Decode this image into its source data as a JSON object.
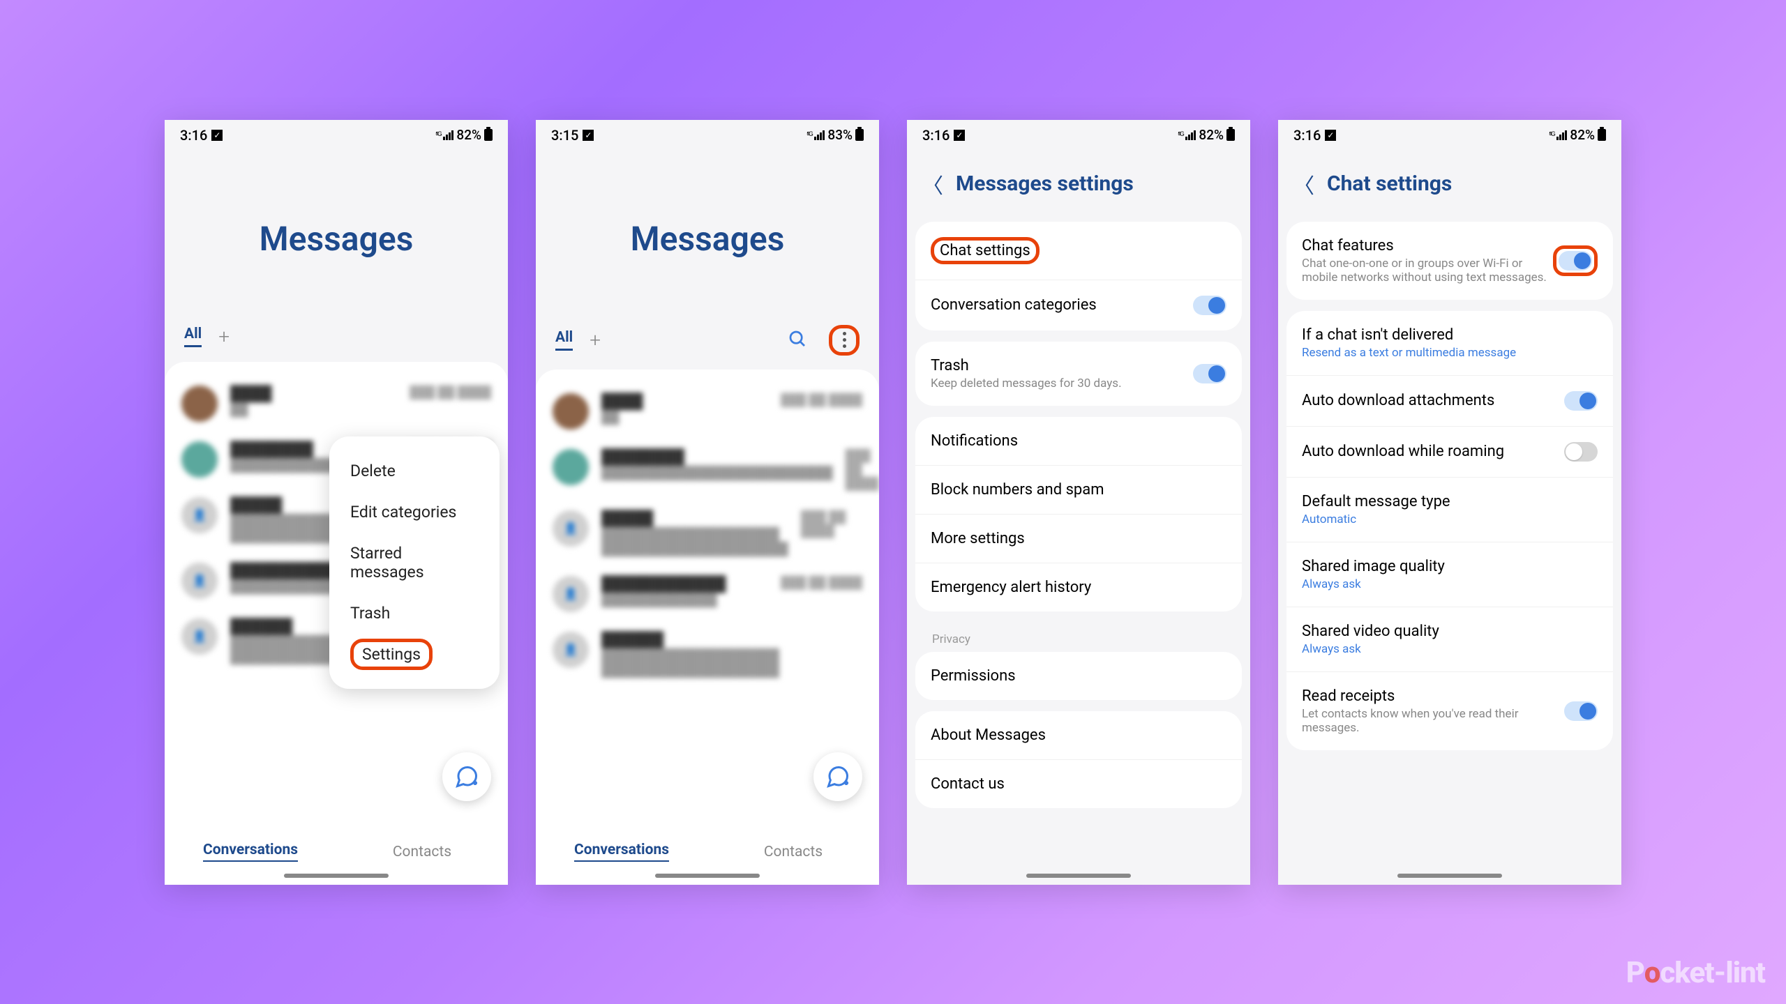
{
  "status": {
    "time1": "3:16",
    "time2": "3:15",
    "battery1": "82%",
    "battery2": "83%"
  },
  "messages": {
    "title": "Messages",
    "tab_all": "All",
    "bottom_conversations": "Conversations",
    "bottom_contacts": "Contacts"
  },
  "popup": {
    "delete": "Delete",
    "edit": "Edit categories",
    "starred": "Starred messages",
    "trash": "Trash",
    "settings": "Settings"
  },
  "msgSettings": {
    "title": "Messages settings",
    "chat": "Chat settings",
    "convcat": "Conversation categories",
    "trash": "Trash",
    "trash_sub": "Keep deleted messages for 30 days.",
    "notif": "Notifications",
    "block": "Block numbers and spam",
    "more": "More settings",
    "emergency": "Emergency alert history",
    "privacy": "Privacy",
    "perms": "Permissions",
    "about": "About Messages",
    "contact": "Contact us"
  },
  "chatSettings": {
    "title": "Chat settings",
    "features": "Chat features",
    "features_sub": "Chat one-on-one or in groups over Wi-Fi or mobile networks without using text messages.",
    "undelivered": "If a chat isn't delivered",
    "undelivered_sub": "Resend as a text or multimedia message",
    "autodl": "Auto download attachments",
    "roaming": "Auto download while roaming",
    "defmsg": "Default message type",
    "defmsg_sub": "Automatic",
    "imgq": "Shared image quality",
    "always": "Always ask",
    "vidq": "Shared video quality",
    "read": "Read receipts",
    "read_sub": "Let contacts know when you've read their messages."
  },
  "watermark": {
    "a": "P",
    "b": "o",
    "c": "cket-lint"
  }
}
